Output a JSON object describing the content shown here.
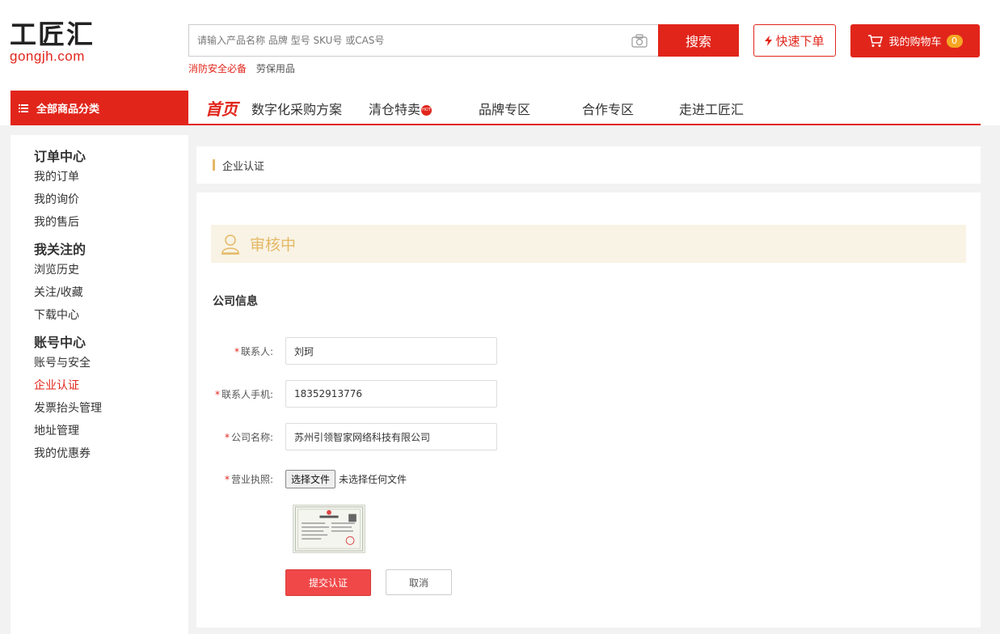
{
  "header": {
    "logo_main": "工匠汇",
    "logo_sub": "gongjh.com",
    "search_placeholder": "请输入产品名称 品牌 型号 SKU号 或CAS号",
    "search_button": "搜索",
    "hot_links": [
      "消防安全必备",
      "劳保用品"
    ],
    "quick_order": "快速下单",
    "cart_label": "我的购物车",
    "cart_count": "0",
    "brand_color": "#e1251b"
  },
  "nav": {
    "category_button": "全部商品分类",
    "items": [
      "首页",
      "数字化采购方案",
      "清仓特卖",
      "品牌专区",
      "合作专区",
      "走进工匠汇"
    ],
    "hot_badge": "HOT"
  },
  "sidebar": {
    "groups": [
      {
        "title": "订单中心",
        "items": [
          "我的订单",
          "我的询价",
          "我的售后"
        ]
      },
      {
        "title": "我关注的",
        "items": [
          "浏览历史",
          "关注/收藏",
          "下载中心"
        ]
      },
      {
        "title": "账号中心",
        "items": [
          "账号与安全",
          "企业认证",
          "发票抬头管理",
          "地址管理",
          "我的优惠券"
        ]
      }
    ],
    "active_item": "企业认证"
  },
  "page": {
    "breadcrumb": "企业认证",
    "status": "审核中",
    "section_title": "公司信息",
    "fields": {
      "contact_label": "联系人:",
      "contact_value": "刘珂",
      "phone_label": "联系人手机:",
      "phone_value": "18352913776",
      "company_label": "公司名称:",
      "company_value": "苏州引领智家网络科技有限公司",
      "license_label": "营业执照:",
      "file_button": "选择文件",
      "file_status": "未选择任何文件"
    },
    "submit": "提交认证",
    "cancel": "取消"
  }
}
